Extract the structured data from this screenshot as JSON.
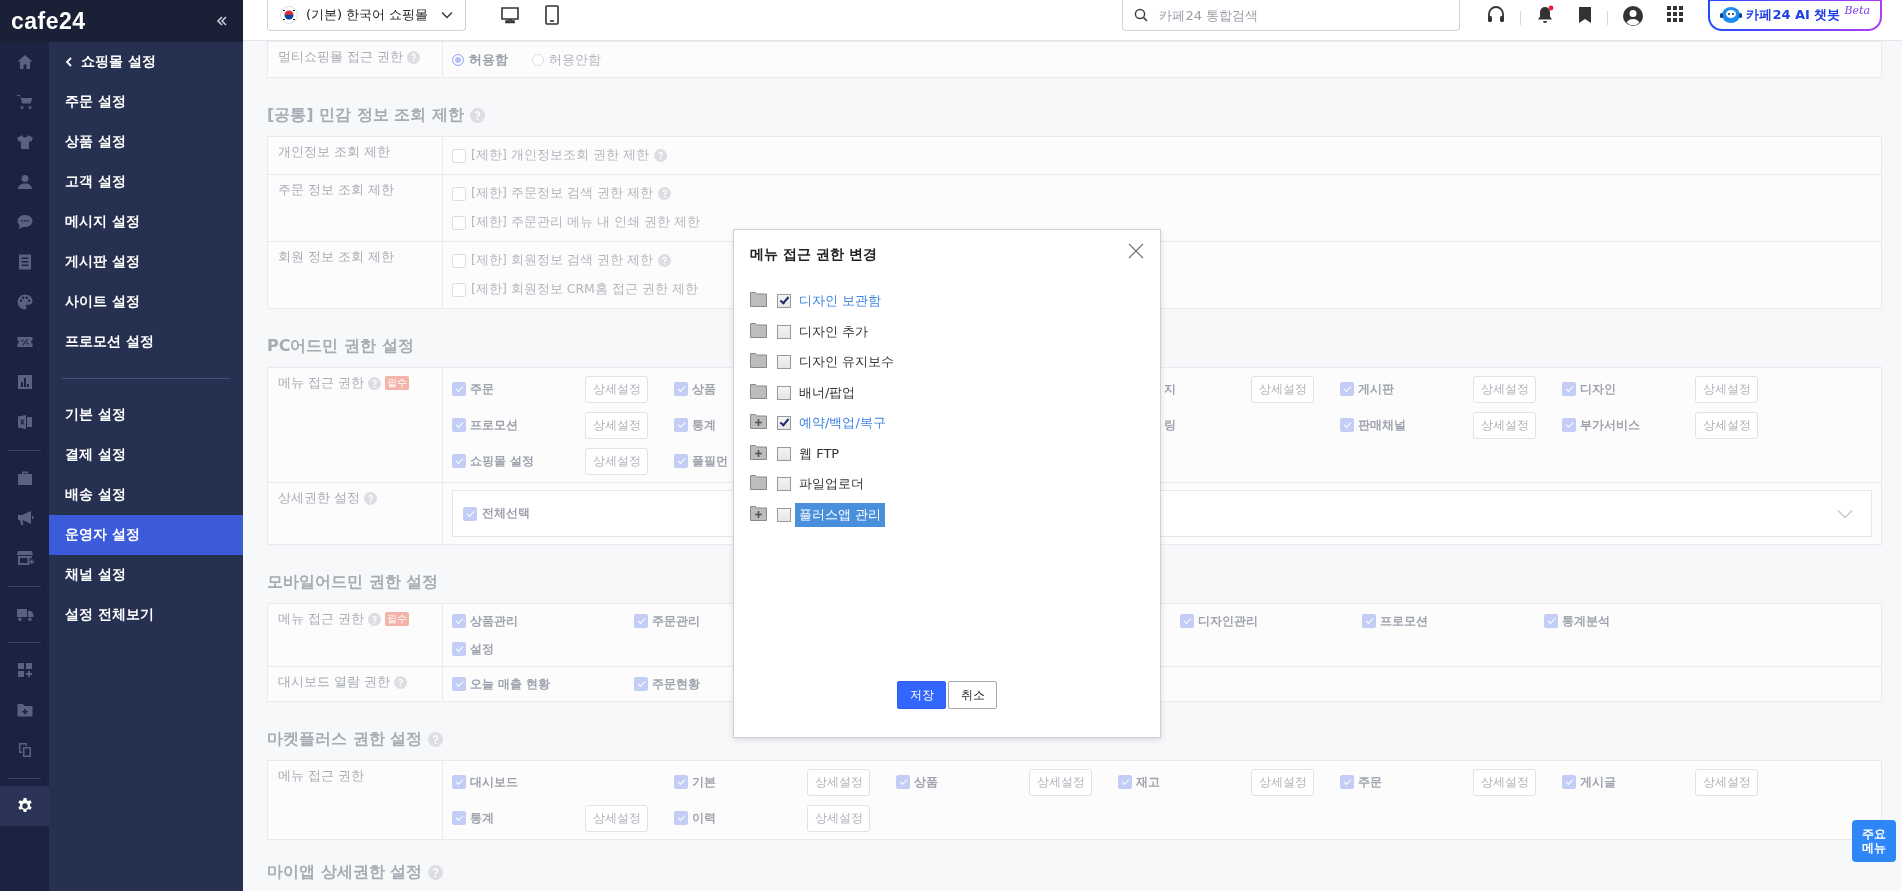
{
  "brand": {
    "logo": "cafe24"
  },
  "rail": [
    [
      {
        "kind": "home",
        "selected": false
      },
      {
        "kind": "cart",
        "selected": false
      },
      {
        "kind": "shirt",
        "selected": false
      },
      {
        "kind": "person",
        "selected": false
      },
      {
        "kind": "chat",
        "selected": false
      },
      {
        "kind": "board",
        "selected": false
      },
      {
        "kind": "palette",
        "selected": false
      },
      {
        "kind": "coupon",
        "selected": false
      },
      {
        "kind": "chart",
        "selected": false
      },
      {
        "kind": "sheet",
        "selected": false
      }
    ],
    [
      {
        "kind": "bag",
        "selected": false
      },
      {
        "kind": "megaphone",
        "selected": false
      },
      {
        "kind": "store",
        "selected": false
      }
    ],
    [
      {
        "kind": "truck",
        "selected": false
      }
    ],
    [
      {
        "kind": "apps",
        "selected": false
      },
      {
        "kind": "folder",
        "selected": false
      },
      {
        "kind": "copy",
        "selected": false
      }
    ],
    [
      {
        "kind": "gear",
        "selected": true
      }
    ]
  ],
  "subnav": {
    "back": "쇼핑몰 설정",
    "groups": [
      [
        {
          "label": "주문 설정",
          "selected": false
        },
        {
          "label": "상품 설정",
          "selected": false
        },
        {
          "label": "고객 설정",
          "selected": false
        },
        {
          "label": "메시지 설정",
          "selected": false
        },
        {
          "label": "게시판 설정",
          "selected": false
        },
        {
          "label": "사이트 설정",
          "selected": false
        },
        {
          "label": "프로모션 설정",
          "selected": false
        }
      ],
      [
        {
          "label": "기본 설정",
          "selected": false
        },
        {
          "label": "결제 설정",
          "selected": false
        },
        {
          "label": "배송 설정",
          "selected": false
        },
        {
          "label": "운영자 설정",
          "selected": true
        },
        {
          "label": "채널 설정",
          "selected": false
        },
        {
          "label": "설정 전체보기",
          "selected": false
        }
      ]
    ]
  },
  "topbar": {
    "shop_select": "(기본) 한국어 쇼핑몰",
    "search": {
      "placeholder": "카페24 통합검색"
    },
    "notification_dot": true,
    "chatbot": {
      "label": "카페24 AI 챗봇",
      "badge": "Beta"
    }
  },
  "sections": [
    {
      "rows": [
        {
          "kind": "radios",
          "label": "멀티쇼핑몰 접근 권한",
          "help": true,
          "options": [
            {
              "label": "허용함",
              "selected": true
            },
            {
              "label": "허용안함",
              "selected": false
            }
          ]
        }
      ]
    },
    {
      "title": "[공통] 민감 정보 조회 제한",
      "help": true,
      "rows": [
        {
          "kind": "checks",
          "label": "개인정보 조회 제한",
          "options": [
            {
              "label": "[제한] 개인정보조회 권한 제한",
              "checked": false,
              "help": true
            }
          ]
        },
        {
          "kind": "checks",
          "label": "주문 정보 조회 제한",
          "options": [
            {
              "label": "[제한] 주문정보 검색 권한 제한",
              "checked": false,
              "help": true
            },
            {
              "label": "[제한] 주문관리 메뉴 내 인쇄 권한 제한",
              "checked": false,
              "help": false
            }
          ]
        },
        {
          "kind": "checks",
          "label": "회원 정보 조회 제한",
          "options": [
            {
              "label": "[제한] 회원정보 검색 권한 제한",
              "checked": false,
              "help": true
            },
            {
              "label": "[제한] 회원정보 CRM홈 접근 권한 제한",
              "checked": false,
              "help": false
            }
          ]
        }
      ]
    },
    {
      "title": "PC어드민 권한 설정",
      "help": false,
      "rows": [
        {
          "kind": "grid",
          "label": "메뉴 접근 권한",
          "help": true,
          "required": "필수",
          "lines": [
            [
              {
                "kind": "item",
                "label": "주문",
                "checked": true,
                "button": "상세설정"
              },
              {
                "kind": "item",
                "label": "상품",
                "checked": true
              },
              {
                "kind": "empty"
              },
              {
                "kind": "tail",
                "label": "지",
                "button": "상세설정"
              },
              {
                "kind": "item",
                "label": "게시판",
                "checked": true,
                "button": "상세설정"
              },
              {
                "kind": "item",
                "label": "디자인",
                "checked": true,
                "button": "상세설정"
              }
            ],
            [
              {
                "kind": "item",
                "label": "프로모션",
                "checked": true,
                "button": "상세설정"
              },
              {
                "kind": "item",
                "label": "통계",
                "checked": true
              },
              {
                "kind": "empty"
              },
              {
                "kind": "tail",
                "label": "링"
              },
              {
                "kind": "item",
                "label": "판매채널",
                "checked": true,
                "button": "상세설정"
              },
              {
                "kind": "item",
                "label": "부가서비스",
                "checked": true,
                "button": "상세설정"
              }
            ],
            [
              {
                "kind": "item",
                "label": "쇼핑몰 설정",
                "checked": true,
                "button": "상세설정"
              },
              {
                "kind": "item",
                "label": "풀필먼",
                "checked": true
              }
            ]
          ]
        },
        {
          "kind": "select-all",
          "label": "상세권한 설정",
          "help": true,
          "option": {
            "label": "전체선택",
            "checked": true
          }
        }
      ]
    },
    {
      "title": "모바일어드민 권한 설정",
      "help": false,
      "rows": [
        {
          "kind": "grid",
          "label": "메뉴 접근 권한",
          "help": true,
          "required": "필수",
          "narrow": true,
          "lines": [
            [
              {
                "kind": "item",
                "label": "상품관리",
                "checked": true
              },
              {
                "kind": "item",
                "label": "주문관리",
                "checked": true
              },
              {
                "kind": "empty"
              },
              {
                "kind": "empty"
              },
              {
                "kind": "item",
                "label": "디자인관리",
                "checked": true
              },
              {
                "kind": "item",
                "label": "프로모션",
                "checked": true
              },
              {
                "kind": "item",
                "label": "통계분석",
                "checked": true
              }
            ],
            [
              {
                "kind": "item",
                "label": "설정",
                "checked": true
              }
            ]
          ]
        },
        {
          "kind": "grid",
          "label": "대시보드 열람 권한",
          "help": true,
          "narrow": true,
          "lines": [
            [
              {
                "kind": "item",
                "label": "오늘 매출 현황",
                "checked": true
              },
              {
                "kind": "item",
                "label": "주문현황",
                "checked": true
              }
            ]
          ]
        }
      ]
    },
    {
      "title": "마켓플러스 권한 설정",
      "help": true,
      "rows": [
        {
          "kind": "grid",
          "label": "메뉴 접근 권한",
          "help": false,
          "lines": [
            [
              {
                "kind": "item",
                "label": "대시보드",
                "checked": true
              },
              {
                "kind": "item",
                "label": "기본",
                "checked": true,
                "button": "상세설정"
              },
              {
                "kind": "item",
                "label": "상품",
                "checked": true,
                "button": "상세설정"
              },
              {
                "kind": "item",
                "label": "재고",
                "checked": true,
                "button": "상세설정"
              },
              {
                "kind": "item",
                "label": "주문",
                "checked": true,
                "button": "상세설정"
              },
              {
                "kind": "item",
                "label": "게시글",
                "checked": true,
                "button": "상세설정"
              }
            ],
            [
              {
                "kind": "item",
                "label": "통계",
                "checked": true,
                "button": "상세설정"
              },
              {
                "kind": "item",
                "label": "이력",
                "checked": true,
                "button": "상세설정"
              }
            ]
          ]
        }
      ]
    },
    {
      "title": "마이앱 상세권한 설정",
      "help": true
    }
  ],
  "modal": {
    "title": "메뉴 접근 권한 변경",
    "items": [
      {
        "label": "디자인 보관함",
        "expandable": false,
        "checked": true,
        "selected": false
      },
      {
        "label": "디자인 추가",
        "expandable": false,
        "checked": false,
        "selected": false
      },
      {
        "label": "디자인 유지보수",
        "expandable": false,
        "checked": false,
        "selected": false
      },
      {
        "label": "배너/팝업",
        "expandable": false,
        "checked": false,
        "selected": false
      },
      {
        "label": "예약/백업/복구",
        "expandable": true,
        "checked": true,
        "selected": false
      },
      {
        "label": "웹 FTP",
        "expandable": true,
        "checked": false,
        "selected": false
      },
      {
        "label": "파일업로더",
        "expandable": false,
        "checked": false,
        "selected": false
      },
      {
        "label": "플러스앱 관리",
        "expandable": true,
        "checked": false,
        "selected": true
      }
    ],
    "buttons": [
      {
        "label": "저장",
        "kind": "primary"
      },
      {
        "label": "취소",
        "kind": "secondary"
      }
    ]
  },
  "floating_button": "주요 메뉴"
}
